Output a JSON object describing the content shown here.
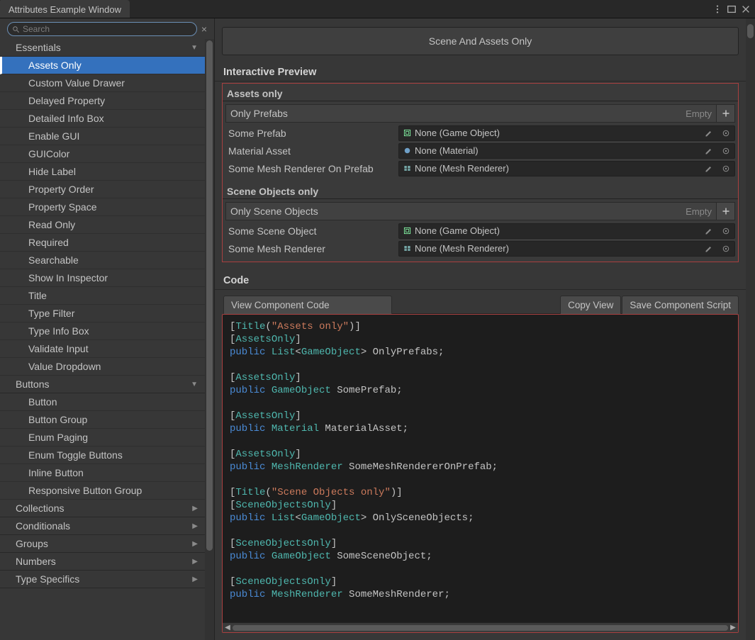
{
  "window": {
    "title": "Attributes Example Window"
  },
  "search": {
    "placeholder": "Search"
  },
  "sidebar": {
    "categories": [
      {
        "label": "Essentials",
        "expanded": true,
        "items": [
          "Assets Only",
          "Custom Value Drawer",
          "Delayed Property",
          "Detailed Info Box",
          "Enable GUI",
          "GUIColor",
          "Hide Label",
          "Property Order",
          "Property Space",
          "Read Only",
          "Required",
          "Searchable",
          "Show In Inspector",
          "Title",
          "Type Filter",
          "Type Info Box",
          "Validate Input",
          "Value Dropdown"
        ],
        "selected_index": 0
      },
      {
        "label": "Buttons",
        "expanded": true,
        "items": [
          "Button",
          "Button Group",
          "Enum Paging",
          "Enum Toggle Buttons",
          "Inline Button",
          "Responsive Button Group"
        ]
      },
      {
        "label": "Collections",
        "expanded": false
      },
      {
        "label": "Conditionals",
        "expanded": false
      },
      {
        "label": "Groups",
        "expanded": false
      },
      {
        "label": "Numbers",
        "expanded": false
      },
      {
        "label": "Type Specifics",
        "expanded": false
      }
    ]
  },
  "main": {
    "title": "Scene And Assets Only",
    "preview_label": "Interactive Preview",
    "assets_title": "Assets only",
    "only_prefabs_label": "Only Prefabs",
    "empty_label": "Empty",
    "fields_assets": [
      {
        "label": "Some Prefab",
        "value": "None (Game Object)",
        "icon": "gameobject"
      },
      {
        "label": "Material Asset",
        "value": "None (Material)",
        "icon": "material"
      },
      {
        "label": "Some Mesh Renderer On Prefab",
        "value": "None (Mesh Renderer)",
        "icon": "mesh"
      }
    ],
    "scene_title": "Scene Objects only",
    "only_scene_label": "Only Scene Objects",
    "fields_scene": [
      {
        "label": "Some Scene Object",
        "value": "None (Game Object)",
        "icon": "gameobject"
      },
      {
        "label": "Some Mesh Renderer",
        "value": "None (Mesh Renderer)",
        "icon": "mesh"
      }
    ],
    "code_label": "Code",
    "code_tabs": {
      "view": "View Component Code",
      "copy": "Copy View",
      "save": "Save Component Script"
    },
    "code": [
      [
        [
          "pl",
          "["
        ],
        [
          "attr",
          "Title"
        ],
        [
          "pl",
          "("
        ],
        [
          "str",
          "\"Assets only\""
        ],
        [
          "pl",
          ")]"
        ]
      ],
      [
        [
          "pl",
          "["
        ],
        [
          "attr",
          "AssetsOnly"
        ],
        [
          "pl",
          "]"
        ]
      ],
      [
        [
          "kw",
          "public "
        ],
        [
          "type",
          "List"
        ],
        [
          "pl",
          "<"
        ],
        [
          "type",
          "GameObject"
        ],
        [
          "pl",
          "> OnlyPrefabs;"
        ]
      ],
      [],
      [
        [
          "pl",
          "["
        ],
        [
          "attr",
          "AssetsOnly"
        ],
        [
          "pl",
          "]"
        ]
      ],
      [
        [
          "kw",
          "public "
        ],
        [
          "type",
          "GameObject"
        ],
        [
          "pl",
          " SomePrefab;"
        ]
      ],
      [],
      [
        [
          "pl",
          "["
        ],
        [
          "attr",
          "AssetsOnly"
        ],
        [
          "pl",
          "]"
        ]
      ],
      [
        [
          "kw",
          "public "
        ],
        [
          "type",
          "Material"
        ],
        [
          "pl",
          " MaterialAsset;"
        ]
      ],
      [],
      [
        [
          "pl",
          "["
        ],
        [
          "attr",
          "AssetsOnly"
        ],
        [
          "pl",
          "]"
        ]
      ],
      [
        [
          "kw",
          "public "
        ],
        [
          "type",
          "MeshRenderer"
        ],
        [
          "pl",
          " SomeMeshRendererOnPrefab;"
        ]
      ],
      [],
      [
        [
          "pl",
          "["
        ],
        [
          "attr",
          "Title"
        ],
        [
          "pl",
          "("
        ],
        [
          "str",
          "\"Scene Objects only\""
        ],
        [
          "pl",
          ")]"
        ]
      ],
      [
        [
          "pl",
          "["
        ],
        [
          "attr",
          "SceneObjectsOnly"
        ],
        [
          "pl",
          "]"
        ]
      ],
      [
        [
          "kw",
          "public "
        ],
        [
          "type",
          "List"
        ],
        [
          "pl",
          "<"
        ],
        [
          "type",
          "GameObject"
        ],
        [
          "pl",
          "> OnlySceneObjects;"
        ]
      ],
      [],
      [
        [
          "pl",
          "["
        ],
        [
          "attr",
          "SceneObjectsOnly"
        ],
        [
          "pl",
          "]"
        ]
      ],
      [
        [
          "kw",
          "public "
        ],
        [
          "type",
          "GameObject"
        ],
        [
          "pl",
          " SomeSceneObject;"
        ]
      ],
      [],
      [
        [
          "pl",
          "["
        ],
        [
          "attr",
          "SceneObjectsOnly"
        ],
        [
          "pl",
          "]"
        ]
      ],
      [
        [
          "kw",
          "public "
        ],
        [
          "type",
          "MeshRenderer"
        ],
        [
          "pl",
          " SomeMeshRenderer;"
        ]
      ]
    ]
  }
}
